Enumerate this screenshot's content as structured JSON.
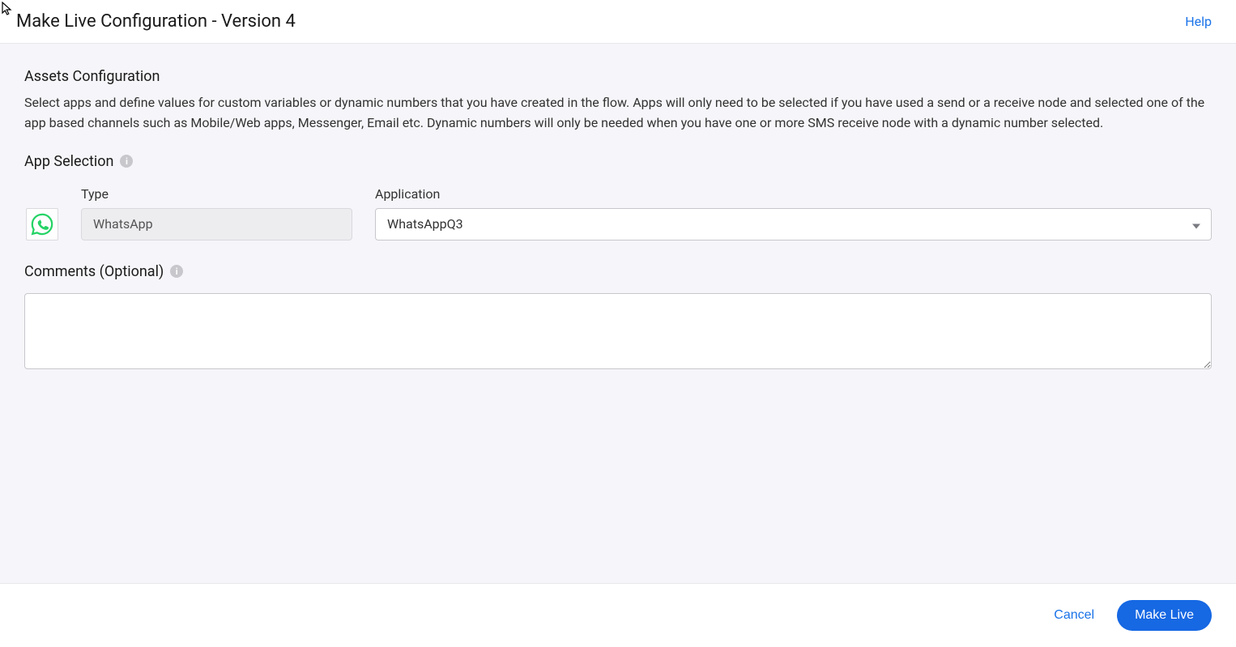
{
  "header": {
    "title": "Make Live Configuration - Version 4",
    "help": "Help"
  },
  "assets": {
    "title": "Assets Configuration",
    "description": "Select apps and define values for custom variables or dynamic numbers that you have created in the flow. Apps will only need to be selected if you have used a send or a receive node and selected one of the app based channels such as Mobile/Web apps, Messenger, Email etc. Dynamic numbers will only be needed when you have one or more SMS receive node with a dynamic number selected."
  },
  "appSelection": {
    "label": "App Selection",
    "icon": "whatsapp",
    "typeLabel": "Type",
    "typeValue": "WhatsApp",
    "applicationLabel": "Application",
    "applicationValue": "WhatsAppQ3"
  },
  "comments": {
    "label": "Comments (Optional)",
    "value": ""
  },
  "footer": {
    "cancel": "Cancel",
    "primary": "Make Live"
  }
}
